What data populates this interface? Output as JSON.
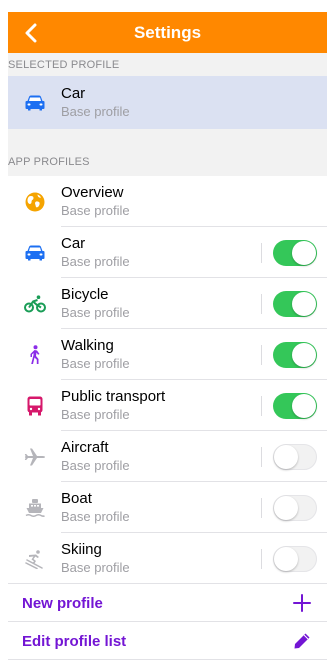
{
  "header": {
    "title": "Settings"
  },
  "selected_section": {
    "label": "SELECTED PROFILE",
    "profile": {
      "name": "Car",
      "subtitle": "Base profile",
      "icon": "car-icon",
      "color": "#1c6ff2"
    }
  },
  "app_section": {
    "label": "APP PROFILES",
    "profiles": [
      {
        "name": "Overview",
        "subtitle": "Base profile",
        "icon": "globe-icon",
        "color": "#f5a400",
        "toggle": null
      },
      {
        "name": "Car",
        "subtitle": "Base profile",
        "icon": "car-icon",
        "color": "#1c6ff2",
        "toggle": true
      },
      {
        "name": "Bicycle",
        "subtitle": "Base profile",
        "icon": "bicycle-icon",
        "color": "#1a9d57",
        "toggle": true
      },
      {
        "name": "Walking",
        "subtitle": "Base profile",
        "icon": "walking-icon",
        "color": "#8b2de8",
        "toggle": true
      },
      {
        "name": "Public transport",
        "subtitle": "Base profile",
        "icon": "bus-icon",
        "color": "#d6186b",
        "toggle": true
      },
      {
        "name": "Aircraft",
        "subtitle": "Base profile",
        "icon": "airplane-icon",
        "color": "#b5b5ba",
        "toggle": false
      },
      {
        "name": "Boat",
        "subtitle": "Base profile",
        "icon": "boat-icon",
        "color": "#b5b5ba",
        "toggle": false
      },
      {
        "name": "Skiing",
        "subtitle": "Base profile",
        "icon": "skiing-icon",
        "color": "#b5b5ba",
        "toggle": false
      }
    ]
  },
  "actions": {
    "new_profile": "New profile",
    "edit_profile_list": "Edit profile list"
  },
  "colors": {
    "brand_orange": "#ff8800",
    "accent_purple": "#7315d4",
    "toggle_on": "#34c759",
    "selected_bg": "#dbe1f2"
  }
}
